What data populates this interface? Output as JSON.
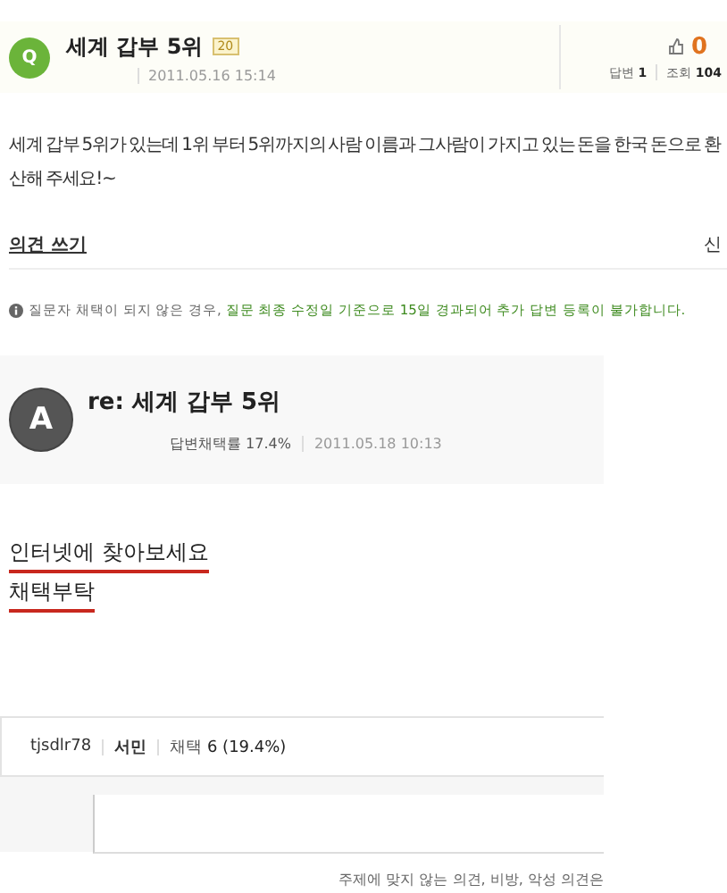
{
  "question": {
    "avatar": "Q",
    "title": "세계 갑부 5위",
    "badge": "20",
    "date": "2011.05.16 15:14",
    "recommend_count": "0",
    "answers_label": "답변",
    "answers_count": "1",
    "views_label": "조회",
    "views_count": "104",
    "body": "세계 갑부 5위가 있는데  1위 부터 5위까지의 사람 이름과  그사람이 가지고 있는 돈을 한국 돈으로 환산해 주세요!~"
  },
  "opinion_link": "의견 쓰기",
  "right_cut": "신",
  "notice": {
    "plain": "질문자 채택이 되지 않은 경우,",
    "highlight": "질문 최종 수정일 기준으로 15일 경과되어 추가 답변 등록이 불가합니다."
  },
  "answer": {
    "avatar": "A",
    "title": "re: 세계 갑부 5위",
    "rate": "답변채택률 17.4%",
    "date": "2011.05.18 10:13",
    "lines": [
      {
        "text": "인터넷에 찾아보세요",
        "underlined": true
      },
      {
        "text": "채택부탁",
        "underlined": true
      }
    ]
  },
  "profile": {
    "user": "tjsdlr78",
    "rank": "서민",
    "adopt_label": "채택",
    "adopt_value": "6 (19.4%)"
  },
  "comment_notice": "주제에 맞지 않는 의견, 비방, 악성 의견은"
}
